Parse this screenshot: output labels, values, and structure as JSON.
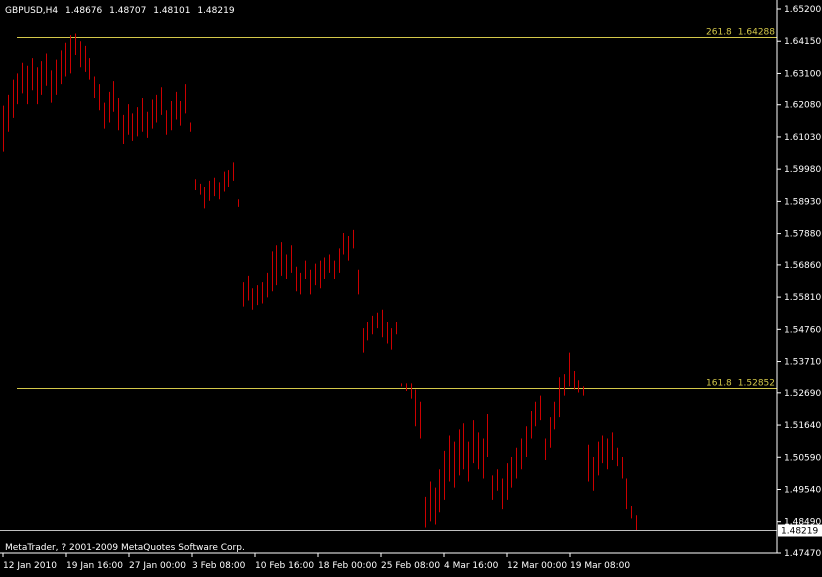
{
  "chart_data": {
    "type": "bar",
    "header": {
      "symbol": "GBPUSD,H4",
      "open": "1.48676",
      "high": "1.48707",
      "low": "1.48101",
      "close": "1.48219"
    },
    "copyright": "MetaTrader, ? 2001-2009 MetaQuotes Software Corp.",
    "ylim": [
      1.4747,
      1.652
    ],
    "y_ticks": [
      "1.65200",
      "1.64150",
      "1.63100",
      "1.62080",
      "1.61030",
      "1.59980",
      "1.58930",
      "1.57880",
      "1.56860",
      "1.55810",
      "1.54760",
      "1.53710",
      "1.52690",
      "1.51640",
      "1.50590",
      "1.49540",
      "1.48490",
      "1.47470"
    ],
    "y_tick_values": [
      1.652,
      1.6415,
      1.631,
      1.6208,
      1.6103,
      1.5998,
      1.5893,
      1.5788,
      1.5686,
      1.5581,
      1.5476,
      1.5371,
      1.5269,
      1.5164,
      1.5059,
      1.4954,
      1.4849,
      1.4747
    ],
    "current_price": "1.48219",
    "current_price_value": 1.48219,
    "x_ticks": [
      "12 Jan 2010",
      "19 Jan 16:00",
      "27 Jan 00:00",
      "3 Feb 08:00",
      "10 Feb 16:00",
      "18 Feb 00:00",
      "25 Feb 08:00",
      "4 Mar 16:00",
      "12 Mar 00:00",
      "19 Mar 08:00"
    ],
    "fibonacci": [
      {
        "level": "261.8",
        "price": "1.64288",
        "value": 1.64288
      },
      {
        "level": "161.8",
        "price": "1.52852",
        "value": 1.52852
      }
    ],
    "colors": {
      "background": "#000000",
      "bars": "#cc0000",
      "fib": "#d4c84a",
      "axis": "#ffffff",
      "price_line": "#c0c0c0"
    },
    "bars": [
      [
        1.6055,
        1.6205
      ],
      [
        1.612,
        1.624
      ],
      [
        1.6165,
        1.629
      ],
      [
        1.621,
        1.631
      ],
      [
        1.6245,
        1.6345
      ],
      [
        1.621,
        1.6335
      ],
      [
        1.6255,
        1.636
      ],
      [
        1.621,
        1.633
      ],
      [
        1.624,
        1.635
      ],
      [
        1.627,
        1.6375
      ],
      [
        1.6215,
        1.632
      ],
      [
        1.624,
        1.6355
      ],
      [
        1.6275,
        1.6385
      ],
      [
        1.63,
        1.641
      ],
      [
        1.631,
        1.6435
      ],
      [
        1.637,
        1.644
      ],
      [
        1.633,
        1.6415
      ],
      [
        1.6315,
        1.64
      ],
      [
        1.629,
        1.636
      ],
      [
        1.623,
        1.63
      ],
      [
        1.619,
        1.6275
      ],
      [
        1.613,
        1.6215
      ],
      [
        1.615,
        1.625
      ],
      [
        1.6185,
        1.6285
      ],
      [
        1.6125,
        1.623
      ],
      [
        1.608,
        1.6175
      ],
      [
        1.611,
        1.621
      ],
      [
        1.609,
        1.618
      ],
      [
        1.6105,
        1.62
      ],
      [
        1.612,
        1.623
      ],
      [
        1.61,
        1.6185
      ],
      [
        1.613,
        1.6225
      ],
      [
        1.615,
        1.624
      ],
      [
        1.6175,
        1.6265
      ],
      [
        1.611,
        1.619
      ],
      [
        1.6125,
        1.622
      ],
      [
        1.616,
        1.625
      ],
      [
        1.614,
        1.622
      ],
      [
        1.618,
        1.6275
      ],
      [
        1.612,
        1.615
      ],
      [
        1.593,
        1.5965
      ],
      [
        1.5915,
        1.595
      ],
      [
        1.587,
        1.594
      ],
      [
        1.5895,
        1.596
      ],
      [
        1.591,
        1.597
      ],
      [
        1.59,
        1.5955
      ],
      [
        1.5925,
        1.599
      ],
      [
        1.594,
        1.5995
      ],
      [
        1.596,
        1.602
      ],
      [
        1.5875,
        1.59
      ],
      [
        1.555,
        1.563
      ],
      [
        1.557,
        1.565
      ],
      [
        1.554,
        1.561
      ],
      [
        1.5555,
        1.562
      ],
      [
        1.556,
        1.563
      ],
      [
        1.558,
        1.566
      ],
      [
        1.56,
        1.573
      ],
      [
        1.562,
        1.575
      ],
      [
        1.565,
        1.576
      ],
      [
        1.564,
        1.572
      ],
      [
        1.566,
        1.575
      ],
      [
        1.56,
        1.568
      ],
      [
        1.559,
        1.566
      ],
      [
        1.564,
        1.57
      ],
      [
        1.559,
        1.567
      ],
      [
        1.562,
        1.569
      ],
      [
        1.561,
        1.57
      ],
      [
        1.564,
        1.571
      ],
      [
        1.566,
        1.572
      ],
      [
        1.564,
        1.57
      ],
      [
        1.566,
        1.574
      ],
      [
        1.572,
        1.579
      ],
      [
        1.57,
        1.578
      ],
      [
        1.574,
        1.58
      ],
      [
        1.559,
        1.567
      ],
      [
        1.54,
        1.548
      ],
      [
        1.544,
        1.55
      ],
      [
        1.546,
        1.552
      ],
      [
        1.548,
        1.553
      ],
      [
        1.545,
        1.554
      ],
      [
        1.543,
        1.55
      ],
      [
        1.541,
        1.548
      ],
      [
        1.546,
        1.55
      ],
      [
        1.529,
        1.53
      ],
      [
        1.5275,
        1.53
      ],
      [
        1.525,
        1.53
      ],
      [
        1.516,
        1.528
      ],
      [
        1.512,
        1.524
      ],
      [
        1.483,
        1.493
      ],
      [
        1.485,
        1.498
      ],
      [
        1.484,
        1.496
      ],
      [
        1.488,
        1.502
      ],
      [
        1.492,
        1.508
      ],
      [
        1.498,
        1.513
      ],
      [
        1.496,
        1.511
      ],
      [
        1.5,
        1.515
      ],
      [
        1.502,
        1.517
      ],
      [
        1.498,
        1.511
      ],
      [
        1.504,
        1.518
      ],
      [
        1.502,
        1.514
      ],
      [
        1.499,
        1.512
      ],
      [
        1.506,
        1.52
      ],
      [
        1.492,
        1.5
      ],
      [
        1.495,
        1.502
      ],
      [
        1.489,
        1.499
      ],
      [
        1.492,
        1.504
      ],
      [
        1.496,
        1.506
      ],
      [
        1.499,
        1.509
      ],
      [
        1.502,
        1.512
      ],
      [
        1.506,
        1.516
      ],
      [
        1.512,
        1.521
      ],
      [
        1.516,
        1.524
      ],
      [
        1.518,
        1.526
      ],
      [
        1.505,
        1.512
      ],
      [
        1.509,
        1.519
      ],
      [
        1.515,
        1.524
      ],
      [
        1.519,
        1.532
      ],
      [
        1.526,
        1.533
      ],
      [
        1.529,
        1.54
      ],
      [
        1.528,
        1.534
      ],
      [
        1.527,
        1.531
      ],
      [
        1.526,
        1.529
      ],
      [
        1.498,
        1.51
      ],
      [
        1.495,
        1.506
      ],
      [
        1.5,
        1.511
      ],
      [
        1.504,
        1.513
      ],
      [
        1.502,
        1.512
      ],
      [
        1.505,
        1.514
      ],
      [
        1.503,
        1.509
      ],
      [
        1.499,
        1.506
      ],
      [
        1.489,
        1.499
      ],
      [
        1.486,
        1.49
      ],
      [
        1.482,
        1.487
      ]
    ]
  }
}
